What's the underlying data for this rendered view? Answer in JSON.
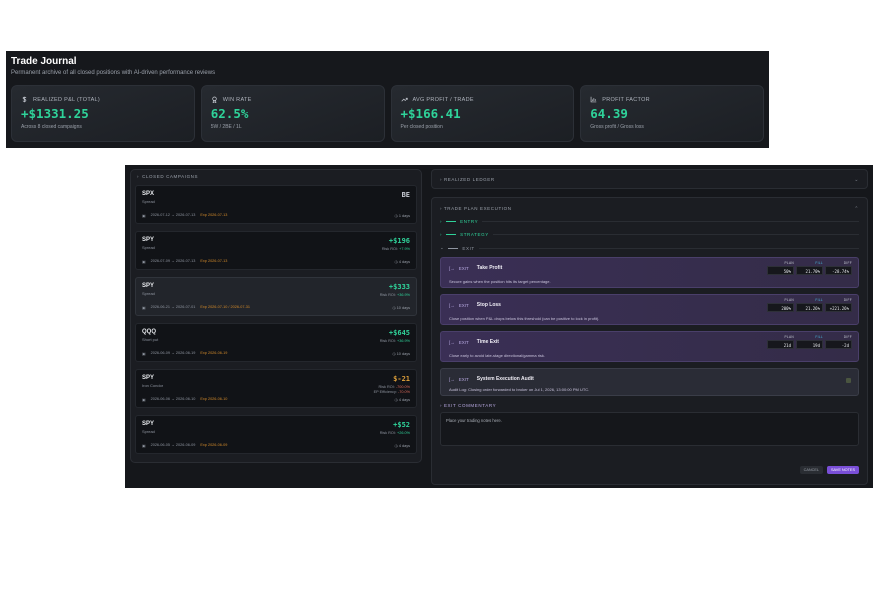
{
  "header": {
    "title": "Trade Journal",
    "subtitle": "Permanent archive of all closed positions with AI-driven performance reviews"
  },
  "stats": [
    {
      "label": "REALIZED P&L (TOTAL)",
      "value": "+$1331.25",
      "note": "Across 8 closed campaigns",
      "icon": "dollar-icon"
    },
    {
      "label": "WIN RATE",
      "value": "62.5%",
      "note": "5W / 2BE / 1L",
      "icon": "award-icon"
    },
    {
      "label": "AVG PROFIT / TRADE",
      "value": "+$166.41",
      "note": "Per closed position",
      "icon": "trend-up-icon"
    },
    {
      "label": "PROFIT FACTOR",
      "value": "64.39",
      "note": "Gross profit / Gross loss",
      "icon": "bar-chart-icon"
    }
  ],
  "campaigns": {
    "label": "CLOSED CAMPAIGNS",
    "items": [
      {
        "symbol": "SPX",
        "type": "Spread",
        "pnl": "BE",
        "tone": "neu",
        "roi_label": "",
        "roi": "",
        "eff_label": "",
        "eff": "",
        "dates": "2026-07-12 → 2026-07-13",
        "exp": "Exp 2026-07-13",
        "days": "1 days"
      },
      {
        "symbol": "SPY",
        "type": "Spread",
        "pnl": "+$196",
        "tone": "pos",
        "roi_label": "Risk ROI: ",
        "roi": "+7.9%",
        "eff_label": "",
        "eff": "",
        "dates": "2026-07-09 → 2026-07-13",
        "exp": "Exp 2026-07-13",
        "days": "4 days"
      },
      {
        "symbol": "SPY",
        "type": "Spread",
        "pnl": "+$333",
        "tone": "pos",
        "roi_label": "Risk ROI: ",
        "roi": "+36.9%",
        "eff_label": "",
        "eff": "",
        "dates": "2026-06-21 → 2026-07-01",
        "exp": "Exp 2026-07-10 / 2026-07-31",
        "days": "10 days"
      },
      {
        "symbol": "QQQ",
        "type": "Short put",
        "pnl": "+$645",
        "tone": "pos",
        "roi_label": "Risk ROI: ",
        "roi": "+36.9%",
        "eff_label": "",
        "eff": "",
        "dates": "2026-06-09 → 2026-06-19",
        "exp": "Exp 2026-06-19",
        "days": "10 days"
      },
      {
        "symbol": "SPY",
        "type": "Iron Condor",
        "pnl": "$-21",
        "tone": "neg",
        "roi_label": "Risk ROI: ",
        "roi": "-700.0%",
        "eff_label": "EP Efficiency: ",
        "eff": "-70.0%",
        "dates": "2026-06-06 → 2026-06-10",
        "exp": "Exp 2026-06-10",
        "days": "4 days"
      },
      {
        "symbol": "SPY",
        "type": "Spread",
        "pnl": "+$52",
        "tone": "pos",
        "roi_label": "Risk ROI: ",
        "roi": "+26.0%",
        "eff_label": "",
        "eff": "",
        "dates": "2026-06-05 → 2026-06-09",
        "exp": "Exp 2026-06-09",
        "days": "4 days"
      }
    ]
  },
  "ledger": {
    "label": "REALIZED LEDGER"
  },
  "plan": {
    "label": "TRADE PLAN EXECUTION",
    "sections": {
      "entry": "ENTRY",
      "strategy": "STRATEGY",
      "exit": "EXIT"
    },
    "metric_headers": {
      "plan": "PLAN",
      "fill": "FILL",
      "diff": "DIFF"
    },
    "rows": [
      {
        "tag": "EXIT",
        "name": "Take Profit",
        "desc": "Secure gains when the position hits its target percentage.",
        "plan": "50%",
        "fill": "21.70%",
        "diff": "-28.74%"
      },
      {
        "tag": "EXIT",
        "name": "Stop Loss",
        "desc": "Close position when P&L drops below this threshold (can be positive to lock in profit).",
        "plan": "200%",
        "fill": "21.26%",
        "diff": "+221.26%"
      },
      {
        "tag": "EXIT",
        "name": "Time Exit",
        "desc": "Close early to avoid late-stage directional/gamma risk.",
        "plan": "21d",
        "fill": "19d",
        "diff": "-2d"
      }
    ],
    "audit": {
      "tag": "EXIT",
      "name": "System Execution Audit",
      "desc": "Audit Log: Closing order forwarded to broker on Jul 1, 2026, 13:00:00 PM UTC."
    }
  },
  "commentary": {
    "label": "EXIT COMMENTARY",
    "placeholder": "Place your trading notes here.",
    "cancel": "CANCEL",
    "save": "SAVE NOTES"
  }
}
